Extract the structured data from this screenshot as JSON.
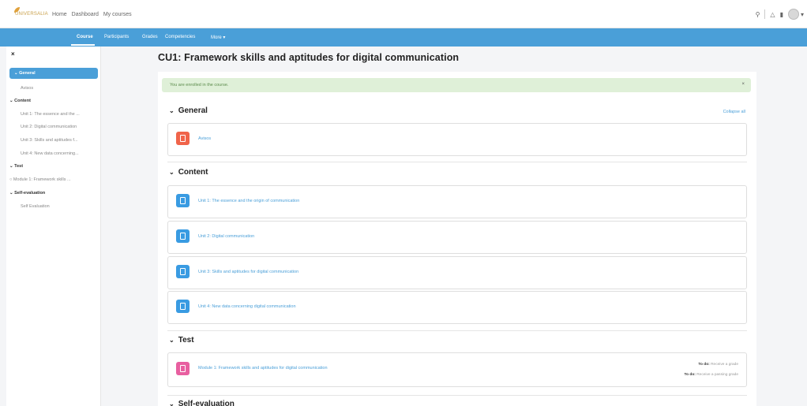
{
  "app": {
    "logo_text": "UNIVERSALIA",
    "top_nav": [
      "Home",
      "Dashboard",
      "My courses"
    ]
  },
  "top_icons": [
    "search-icon",
    "bell-icon",
    "message-icon",
    "user-avatar"
  ],
  "secondary_nav": {
    "tabs": [
      "Course",
      "Participants",
      "Grades",
      "Competencies",
      "More ▾"
    ],
    "active": "Course"
  },
  "sidebar": {
    "close_label": "×",
    "items": [
      {
        "label": "⌄  General",
        "kind": "section",
        "active": true
      },
      {
        "label": "Avisos",
        "kind": "sub"
      },
      {
        "label": "⌄  Content",
        "kind": "section"
      },
      {
        "label": "Unit 1: The essence and the ...",
        "kind": "sub"
      },
      {
        "label": "Unit 2: Digital communication",
        "kind": "sub"
      },
      {
        "label": "Unit 3: Skills and aptitudes f...",
        "kind": "sub"
      },
      {
        "label": "Unit 4: New data concerning...",
        "kind": "sub"
      },
      {
        "label": "⌄  Test",
        "kind": "section"
      },
      {
        "label": "○  Module 1: Framework skills ...",
        "kind": "item"
      },
      {
        "label": "⌄  Self-evaluation",
        "kind": "section"
      },
      {
        "label": "Self Evaluation",
        "kind": "sub"
      }
    ]
  },
  "main": {
    "title": "CU1: Framework skills and aptitudes for digital communication",
    "alert": "You are enrolled in the course.",
    "alert_close": "×",
    "collapse_all": "Collapse all",
    "sections": [
      {
        "name": "General",
        "chevron": "⌄"
      },
      {
        "name": "Content",
        "chevron": "⌄"
      },
      {
        "name": "Test",
        "chevron": "⌄"
      },
      {
        "name": "Self-evaluation",
        "chevron": "⌄"
      }
    ],
    "activities": [
      {
        "name": "Avisos",
        "icon": "forum-icon",
        "color": "#f0644a"
      },
      {
        "name": "Unit 1: The essence and the origin of communication",
        "icon": "page-icon",
        "color": "#399be2"
      },
      {
        "name": "Unit 2: Digital communication",
        "icon": "page-icon",
        "color": "#399be2"
      },
      {
        "name": "Unit 3: Skills and aptitudes for digital communication",
        "icon": "page-icon",
        "color": "#399be2"
      },
      {
        "name": "Unit 4: New data concerning digital communication",
        "icon": "page-icon",
        "color": "#399be2"
      },
      {
        "name": "Module 1: Framework skills and aptitudes for digital communication",
        "icon": "quiz-icon",
        "color": "#e85fa0"
      }
    ],
    "todo": [
      {
        "label": "To do:",
        "text": "Receive a grade"
      },
      {
        "label": "To do:",
        "text": "Receive a passing grade"
      }
    ]
  }
}
